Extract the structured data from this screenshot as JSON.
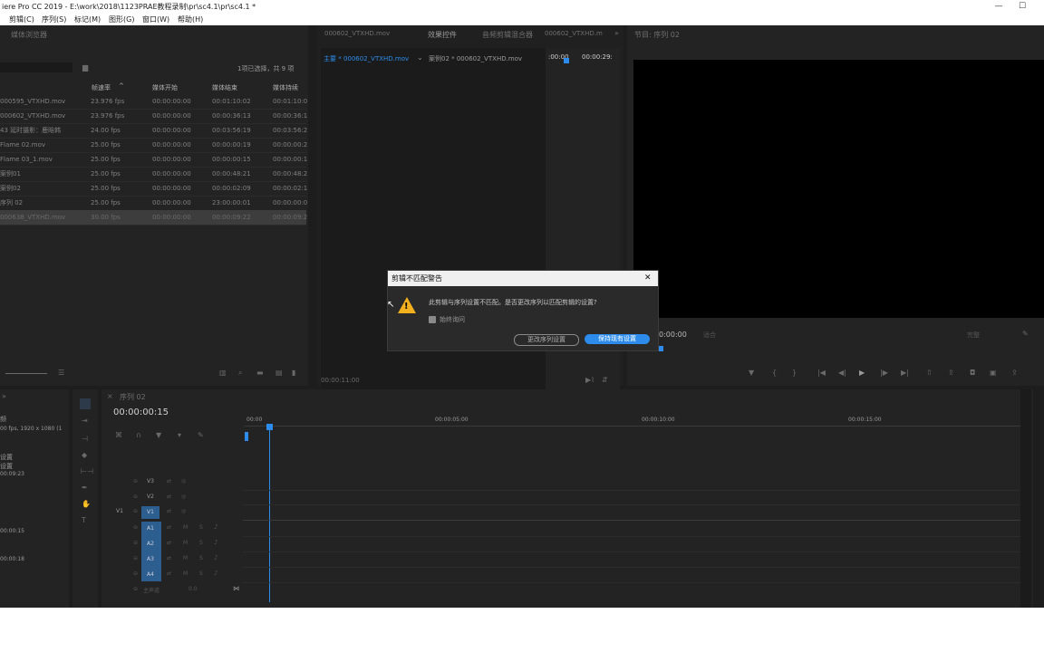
{
  "window": {
    "title": "iere Pro CC 2019 - E:\\work\\2018\\1123PRAE教程录制\\pr\\sc4.1\\pr\\sc4.1 *",
    "min": "—",
    "max": "☐"
  },
  "menu": [
    "剪辑(C)",
    "序列(S)",
    "标记(M)",
    "图形(G)",
    "窗口(W)",
    "帮助(H)"
  ],
  "project": {
    "tab": "媒体浏览器",
    "status": "1项已选择，共 9 项",
    "columns": [
      "帧速率",
      "媒体开始",
      "媒体结束",
      "媒体持续"
    ],
    "rows": [
      {
        "name": "000595_VTXHD.mov",
        "fps": "23.976 fps",
        "start": "00:00:00:00",
        "end": "00:01:10:02",
        "dur": "00:01:10:0"
      },
      {
        "name": "000602_VTXHD.mov",
        "fps": "23.976 fps",
        "start": "00:00:00:00",
        "end": "00:00:36:13",
        "dur": "00:00:36:1"
      },
      {
        "name": "43 延时摄影：鹿晗韩",
        "fps": "24.00 fps",
        "start": "00:00:00:00",
        "end": "00:03:56:19",
        "dur": "00:03:56:2"
      },
      {
        "name": "Flame 02.mov",
        "fps": "25.00 fps",
        "start": "00:00:00:00",
        "end": "00:00:00:19",
        "dur": "00:00:00:2"
      },
      {
        "name": "Flame 03_1.mov",
        "fps": "25.00 fps",
        "start": "00:00:00:00",
        "end": "00:00:00:15",
        "dur": "00:00:00:1"
      },
      {
        "name": "案例01",
        "fps": "25.00 fps",
        "start": "00:00:00:00",
        "end": "00:00:48:21",
        "dur": "00:00:48:2"
      },
      {
        "name": "案例02",
        "fps": "25.00 fps",
        "start": "00:00:00:00",
        "end": "00:00:02:09",
        "dur": "00:00:02:1"
      },
      {
        "name": "序列 02",
        "fps": "25.00 fps",
        "start": "00:00:00:00",
        "end": "23:00:00:01",
        "dur": "00:00:00:0"
      },
      {
        "name": "000638_VTXHD.mov",
        "fps": "30.00 fps",
        "start": "00:00:00:00",
        "end": "00:00:09:22",
        "dur": "00:00:09:2"
      }
    ]
  },
  "source": {
    "tabs": [
      "000602_VTXHD.mov",
      "效果控件",
      "音频剪辑混合器",
      "000602_VTXHD.m"
    ],
    "master": "主要 * 000602_VTXHD.mov",
    "clip": "案例02 * 000602_VTXHD.mov",
    "tc_left": ":00:00",
    "tc_right": "00:00:29:",
    "bottom_tc": "00:00:11:00"
  },
  "program": {
    "tab": "节目: 序列 02",
    "tc": "0:00:00",
    "fit": "适合",
    "quality": "完整"
  },
  "dialog": {
    "title": "剪辑不匹配警告",
    "close": "✕",
    "message": "此剪辑与序列设置不匹配。是否更改序列以匹配剪辑的设置?",
    "checkbox": "始终询问",
    "btn_change": "更改序列设置",
    "btn_keep": "保持现有设置"
  },
  "timeline": {
    "tab": "序列 02",
    "tc": "00:00:00:15",
    "ruler": [
      "00:00",
      "00:00:05:00",
      "00:00:10:00",
      "00:00:15:00"
    ],
    "video_tracks": [
      "V3",
      "V2",
      "V1"
    ],
    "audio_tracks": [
      "A1",
      "A2",
      "A3",
      "A4"
    ],
    "v1_label": "V1",
    "master": "主声道",
    "master_val": "0.0"
  },
  "left_small": {
    "info1": "频",
    "info2": "00 fps, 1920 x 1080 (1",
    "info3": "设置",
    "info4": "设置",
    "info5": "00:09:23",
    "info6": "00:00:15",
    "info7": "00:00:18"
  },
  "colors": {
    "accent": "#2d8ceb",
    "track_blue": "#2c5f8f",
    "bg": "#1d1d1d"
  }
}
